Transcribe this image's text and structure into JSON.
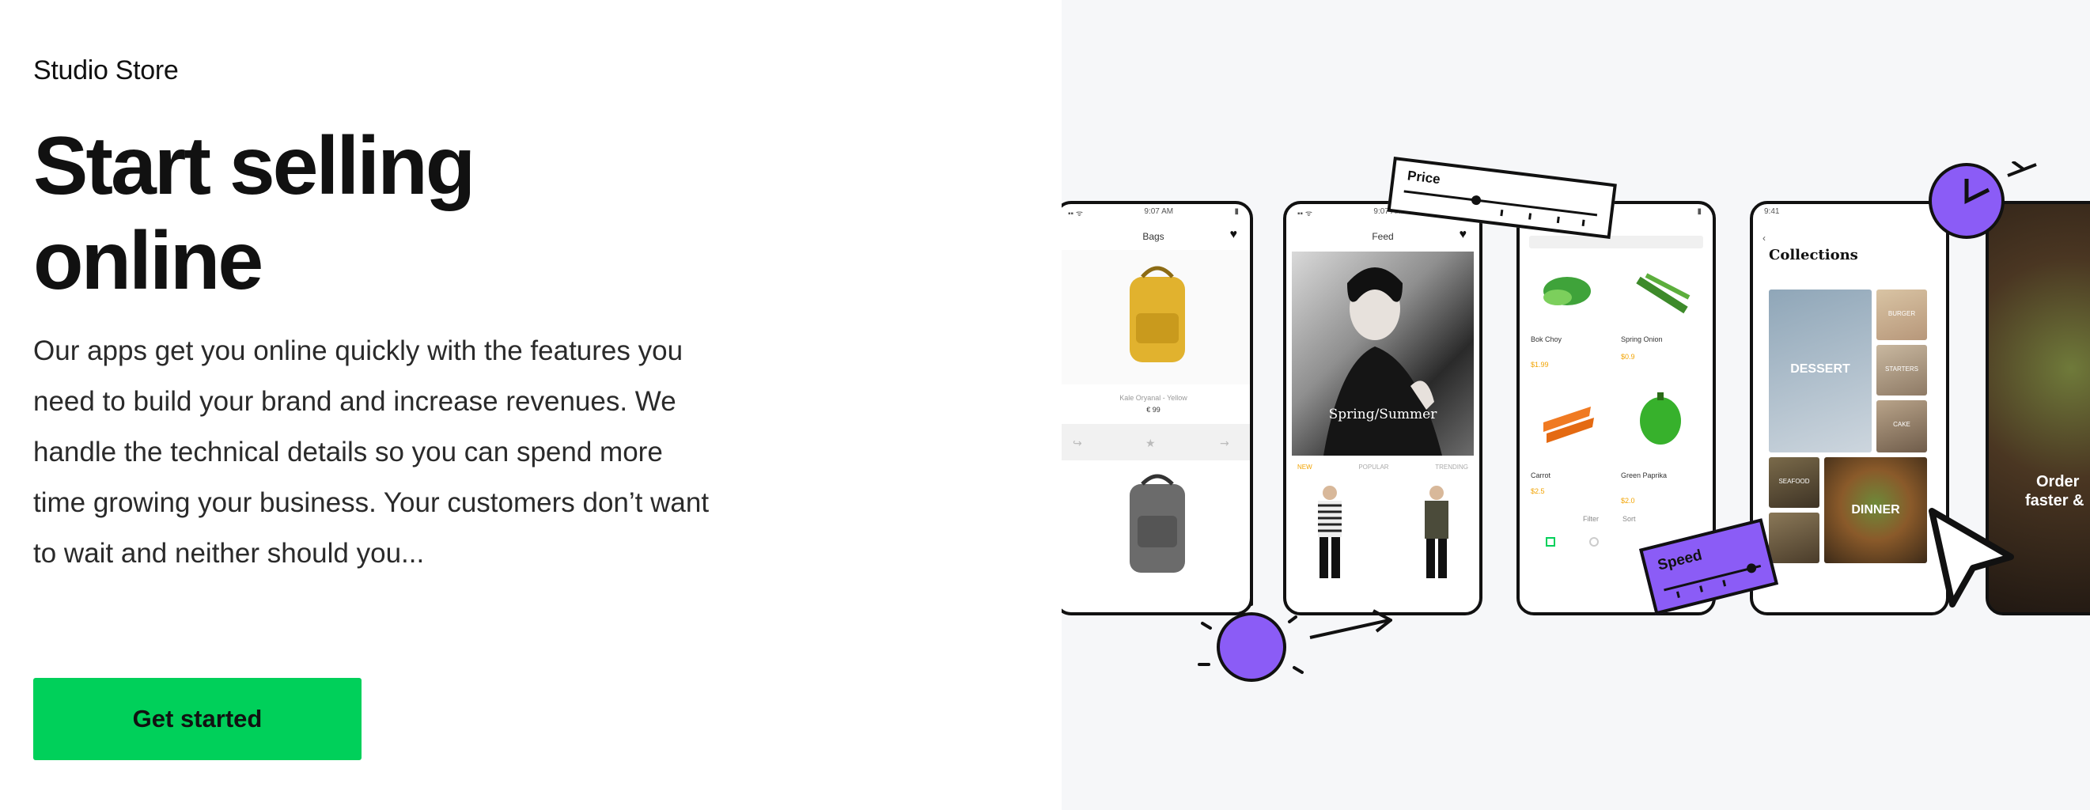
{
  "brand": "Studio Store",
  "hero": {
    "headline_line1": "Start selling",
    "headline_line2": "online",
    "body": "Our apps get you online quickly with the features you need to build your brand and increase revenues. We handle the technical details so you can spend more time growing your business. Your customers don’t want to wait and neither should you...",
    "cta_label": "Get started"
  },
  "illustration": {
    "price_label": "Price",
    "speed_label": "Speed",
    "phone_bags": {
      "time": "9:07 AM",
      "title": "Bags",
      "product1": "Kale Oryanal - Yellow",
      "price1": "€ 99"
    },
    "phone_feed": {
      "time": "9:07 AM",
      "title": "Feed",
      "banner": "Spring/Summer",
      "tabs": [
        "NEW",
        "POPULAR",
        "TRENDING"
      ]
    },
    "phone_grocery": {
      "items": [
        {
          "name": "Bok Choy",
          "price": "$1.99"
        },
        {
          "name": "Spring Onion",
          "price": "$0.9"
        },
        {
          "name": "Carrot",
          "price": "$2.5"
        },
        {
          "name": "Green Paprika",
          "price": "$2.0"
        }
      ],
      "filter": "Filter",
      "sort": "Sort"
    },
    "phone_collections": {
      "time": "9:41",
      "title": "Collections",
      "tiles": [
        "DESSERT",
        "BURGER",
        "STARTERS",
        "SEAFOOD",
        "CAKE",
        "DINNER"
      ]
    },
    "phone_order": {
      "text1": "Order",
      "text2": "faster &"
    }
  },
  "colors": {
    "accent_green": "#00d05a",
    "accent_purple": "#8b5cf6",
    "panel_bg": "#f6f7f9"
  }
}
